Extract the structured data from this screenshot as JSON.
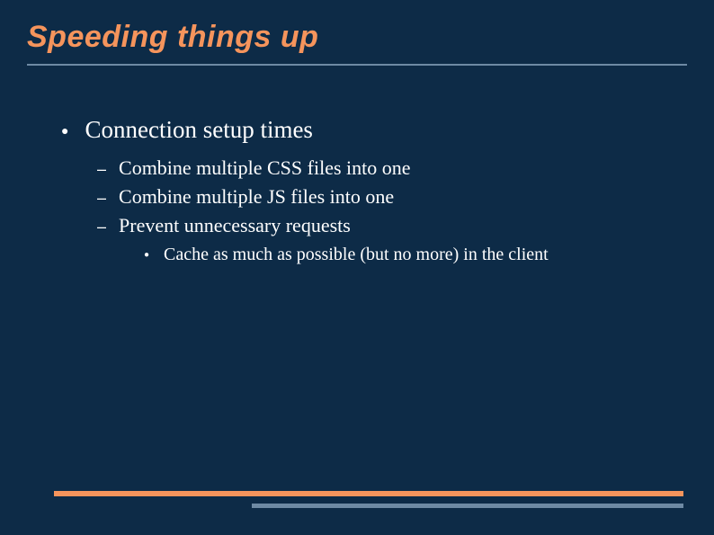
{
  "title": "Speeding things up",
  "main": {
    "heading": "Connection setup times",
    "items": [
      "Combine multiple CSS files into one",
      "Combine multiple JS files into one",
      "Prevent unnecessary requests"
    ],
    "subitem": "Cache as much as possible (but no more) in the client"
  }
}
